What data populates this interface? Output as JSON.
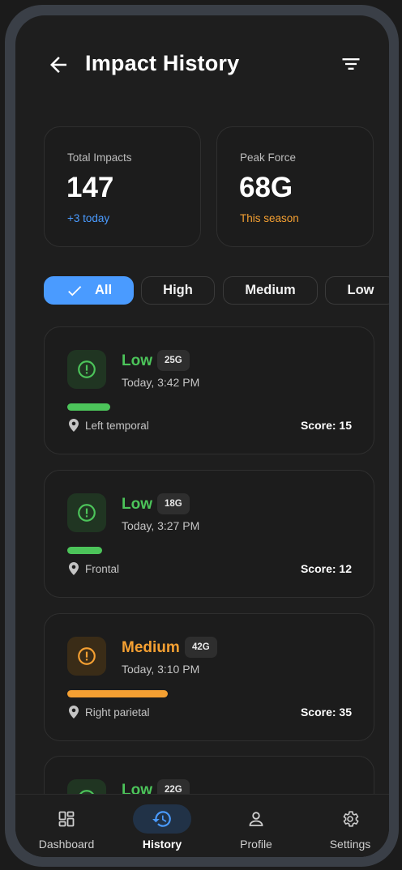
{
  "header": {
    "title": "Impact History"
  },
  "stats": [
    {
      "label": "Total Impacts",
      "value": "147",
      "sub": "+3 today",
      "sub_color": "#4a9bff"
    },
    {
      "label": "Peak Force",
      "value": "68G",
      "sub": "This season",
      "sub_color": "#f5a032"
    }
  ],
  "filters": [
    {
      "label": "All",
      "active": true
    },
    {
      "label": "High",
      "active": false
    },
    {
      "label": "Medium",
      "active": false
    },
    {
      "label": "Low",
      "active": false
    }
  ],
  "impacts": [
    {
      "level": "Low",
      "force": "25G",
      "time": "Today, 3:42 PM",
      "location": "Left temporal",
      "score": "Score: 15",
      "color": "#4cc45a",
      "severity": 0.15
    },
    {
      "level": "Low",
      "force": "18G",
      "time": "Today, 3:27 PM",
      "location": "Frontal",
      "score": "Score: 12",
      "color": "#4cc45a",
      "severity": 0.12
    },
    {
      "level": "Medium",
      "force": "42G",
      "time": "Today, 3:10 PM",
      "location": "Right parietal",
      "score": "Score: 35",
      "color": "#f5a032",
      "severity": 0.35
    },
    {
      "level": "Low",
      "force": "22G",
      "time": "",
      "location": "",
      "score": "",
      "color": "#4cc45a",
      "severity": 0.14
    }
  ],
  "nav": [
    {
      "label": "Dashboard",
      "icon": "dashboard-icon",
      "active": false
    },
    {
      "label": "History",
      "icon": "history-icon",
      "active": true
    },
    {
      "label": "Profile",
      "icon": "profile-icon",
      "active": false
    },
    {
      "label": "Settings",
      "icon": "settings-icon",
      "active": false
    }
  ],
  "colors": {
    "accent": "#4a9bff",
    "low": "#4cc45a",
    "medium": "#f5a032",
    "background": "#1e1e1e"
  }
}
